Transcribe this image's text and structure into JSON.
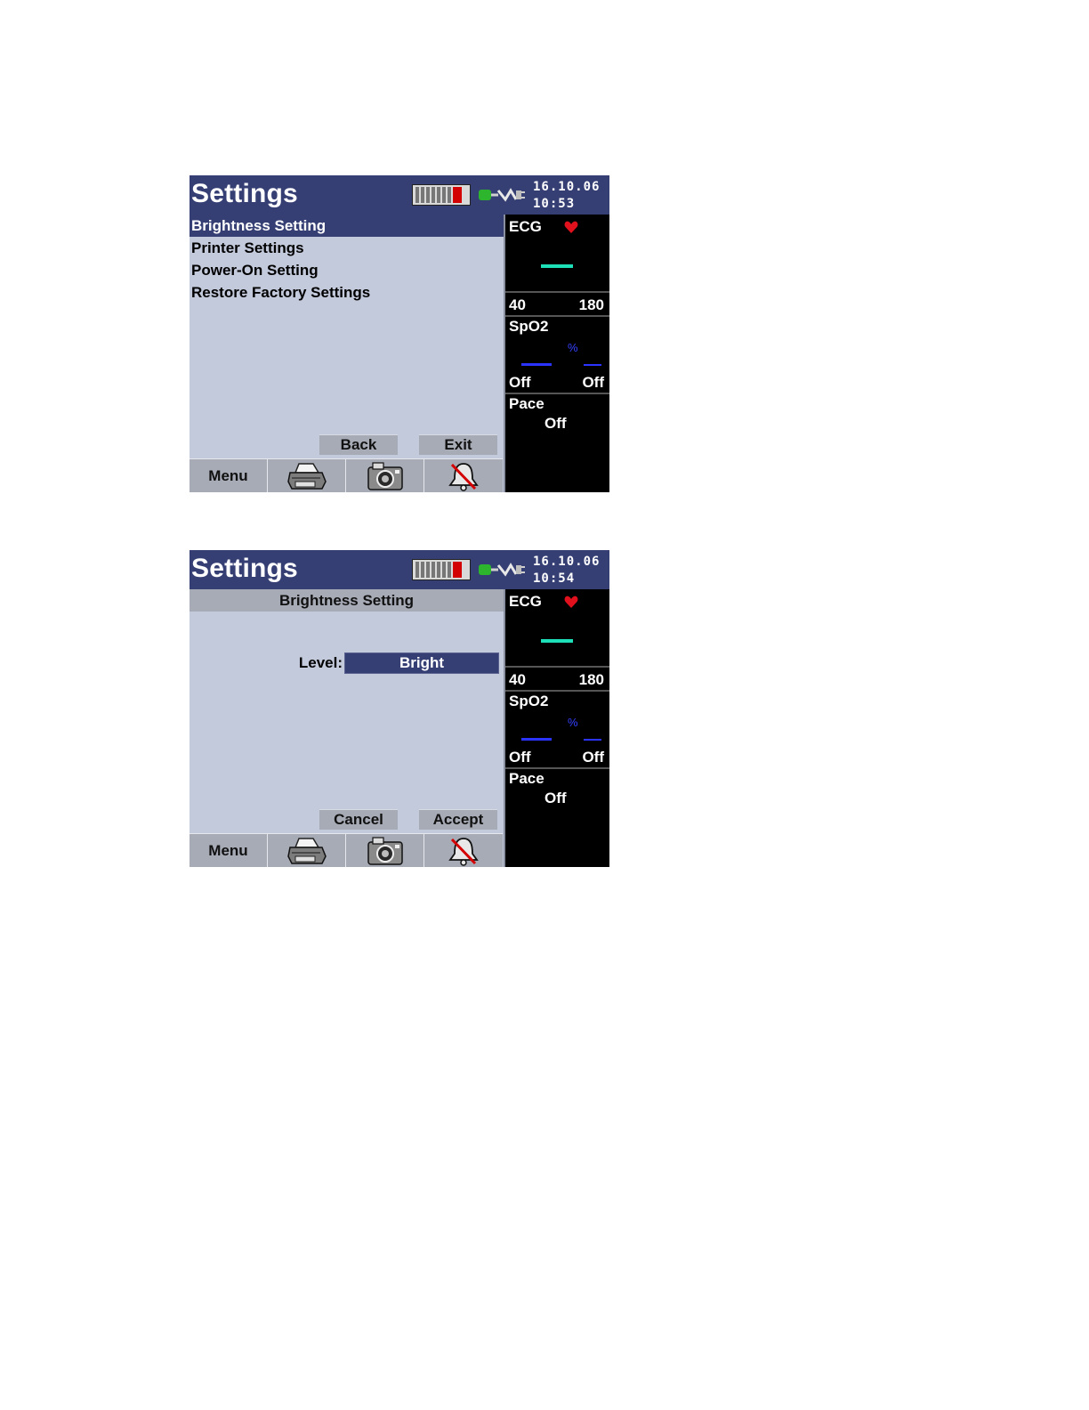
{
  "screens": [
    {
      "title": "Settings",
      "date": "16.10.06",
      "time": "10:53",
      "menu_items": [
        "Brightness Setting",
        "Printer Settings",
        "Power-On Setting",
        "Restore Factory Settings"
      ],
      "selected_index": 0,
      "softkeys": {
        "left": "Back",
        "right": "Exit"
      },
      "toolbar": {
        "menu_label": "Menu"
      },
      "monitor": {
        "ecg_label": "ECG",
        "ecg_low": "40",
        "ecg_high": "180",
        "spo2_label": "SpO2",
        "spo2_unit": "%",
        "spo2_left": "Off",
        "spo2_right": "Off",
        "pace_label": "Pace",
        "pace_value": "Off"
      }
    },
    {
      "title": "Settings",
      "date": "16.10.06",
      "time": "10:54",
      "panel_heading": "Brightness Setting",
      "level_label": "Level:",
      "level_value": "Bright",
      "softkeys": {
        "left": "Cancel",
        "right": "Accept"
      },
      "toolbar": {
        "menu_label": "Menu"
      },
      "monitor": {
        "ecg_label": "ECG",
        "ecg_low": "40",
        "ecg_high": "180",
        "spo2_label": "SpO2",
        "spo2_unit": "%",
        "spo2_left": "Off",
        "spo2_right": "Off",
        "pace_label": "Pace",
        "pace_value": "Off"
      }
    }
  ],
  "icons": [
    "battery-icon",
    "ac-power-plug-icon",
    "heart-icon",
    "printer-icon",
    "camera-icon",
    "alarm-silenced-icon"
  ],
  "colors": {
    "title_bar": "#353f74",
    "content_bg": "#c3cadc",
    "button_bg": "#a7abb6",
    "ecg_trace": "#1ee0b8",
    "spo2_trace": "#2b34ff",
    "heart": "#e0101c",
    "battery_level": "#d20000"
  }
}
